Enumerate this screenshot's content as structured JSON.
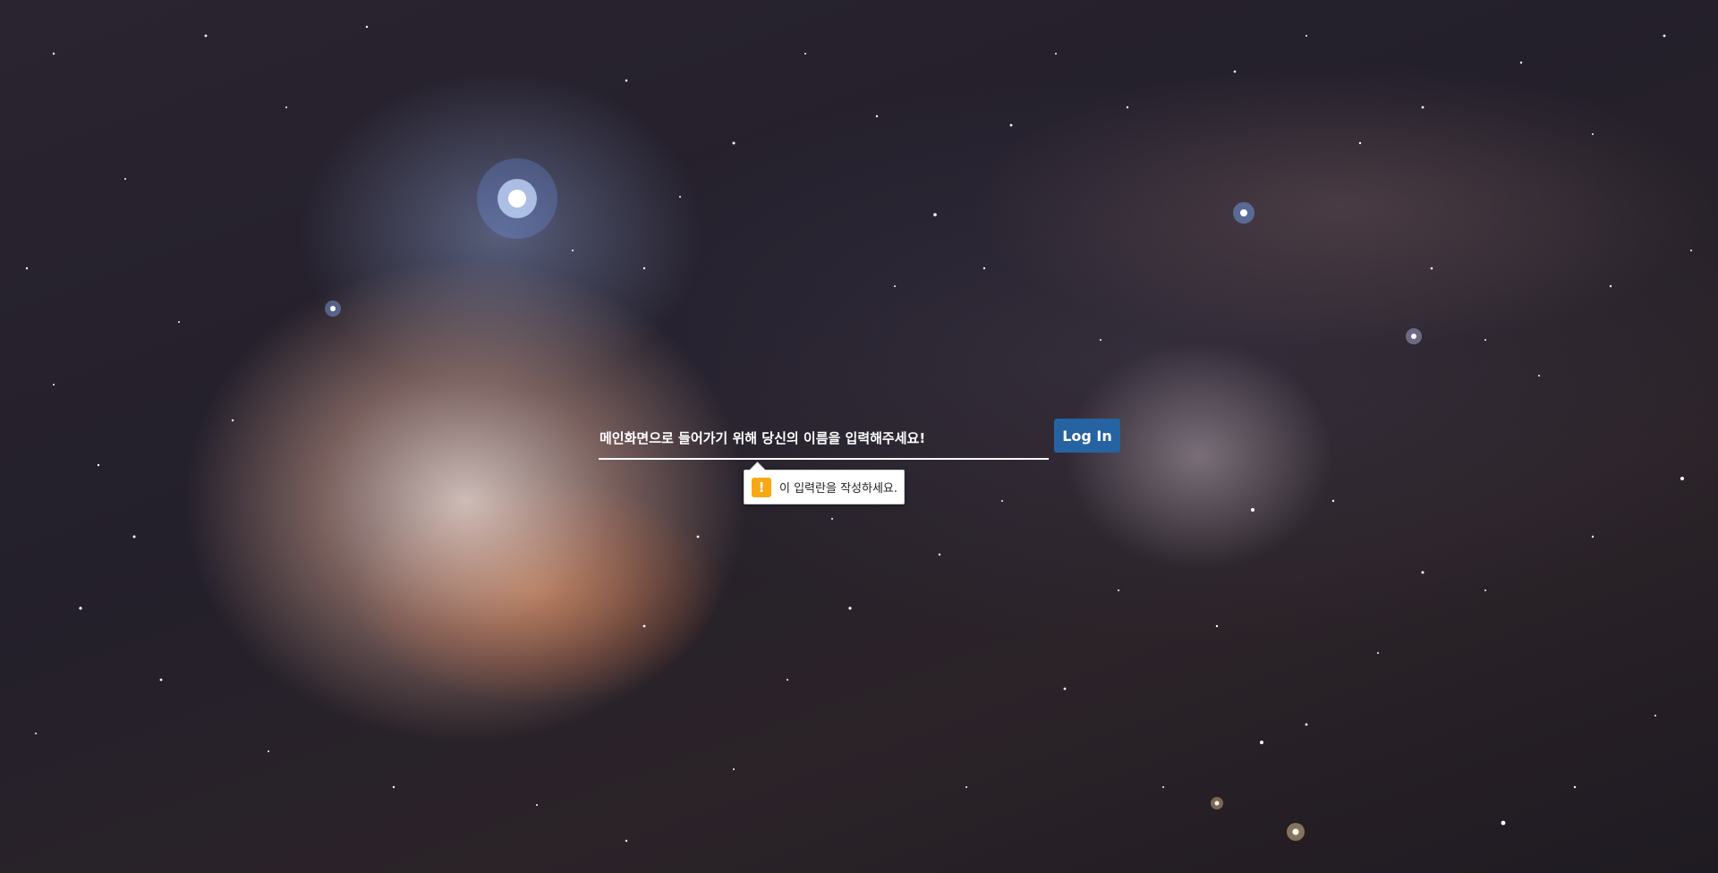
{
  "background": {
    "image": "space-nebula-background"
  },
  "login_form": {
    "name_input": {
      "placeholder": "메인화면으로 들어가기 위해 당신의 이름을 입력해주세요!",
      "value": ""
    },
    "login_button_label": "Log In"
  },
  "validation_tooltip": {
    "icon": "warning-icon",
    "icon_glyph": "!",
    "message": "이 입력란을 작성하세요.",
    "icon_color": "#f7a813"
  },
  "colors": {
    "button": "#2563a3",
    "input_underline": "#ffffff"
  }
}
